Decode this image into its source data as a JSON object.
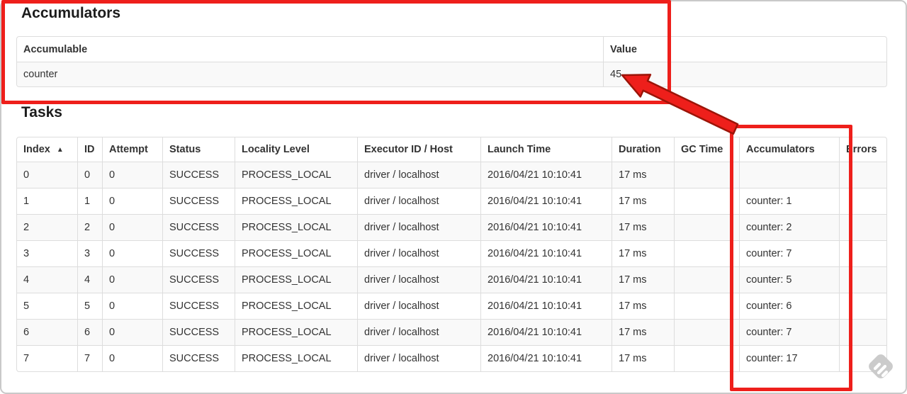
{
  "annotation_color": "#ee1f1b",
  "accumulators_section": {
    "heading": "Accumulators",
    "table": {
      "headers": {
        "accumulable": "Accumulable",
        "value": "Value"
      },
      "row": {
        "accumulable": "counter",
        "value": "45"
      }
    }
  },
  "tasks_section": {
    "heading": "Tasks",
    "table": {
      "headers": [
        "Index",
        "ID",
        "Attempt",
        "Status",
        "Locality Level",
        "Executor ID / Host",
        "Launch Time",
        "Duration",
        "GC Time",
        "Accumulators",
        "Errors"
      ],
      "sort": {
        "column": "Index",
        "direction_icon": "▲"
      },
      "rows": [
        {
          "index": "0",
          "id": "0",
          "attempt": "0",
          "status": "SUCCESS",
          "locality_level": "PROCESS_LOCAL",
          "executor_id_host": "driver / localhost",
          "launch_time": "2016/04/21 10:10:41",
          "duration": "17 ms",
          "gc_time": "",
          "accumulators": "",
          "errors": ""
        },
        {
          "index": "1",
          "id": "1",
          "attempt": "0",
          "status": "SUCCESS",
          "locality_level": "PROCESS_LOCAL",
          "executor_id_host": "driver / localhost",
          "launch_time": "2016/04/21 10:10:41",
          "duration": "17 ms",
          "gc_time": "",
          "accumulators": "counter: 1",
          "errors": ""
        },
        {
          "index": "2",
          "id": "2",
          "attempt": "0",
          "status": "SUCCESS",
          "locality_level": "PROCESS_LOCAL",
          "executor_id_host": "driver / localhost",
          "launch_time": "2016/04/21 10:10:41",
          "duration": "17 ms",
          "gc_time": "",
          "accumulators": "counter: 2",
          "errors": ""
        },
        {
          "index": "3",
          "id": "3",
          "attempt": "0",
          "status": "SUCCESS",
          "locality_level": "PROCESS_LOCAL",
          "executor_id_host": "driver / localhost",
          "launch_time": "2016/04/21 10:10:41",
          "duration": "17 ms",
          "gc_time": "",
          "accumulators": "counter: 7",
          "errors": ""
        },
        {
          "index": "4",
          "id": "4",
          "attempt": "0",
          "status": "SUCCESS",
          "locality_level": "PROCESS_LOCAL",
          "executor_id_host": "driver / localhost",
          "launch_time": "2016/04/21 10:10:41",
          "duration": "17 ms",
          "gc_time": "",
          "accumulators": "counter: 5",
          "errors": ""
        },
        {
          "index": "5",
          "id": "5",
          "attempt": "0",
          "status": "SUCCESS",
          "locality_level": "PROCESS_LOCAL",
          "executor_id_host": "driver / localhost",
          "launch_time": "2016/04/21 10:10:41",
          "duration": "17 ms",
          "gc_time": "",
          "accumulators": "counter: 6",
          "errors": ""
        },
        {
          "index": "6",
          "id": "6",
          "attempt": "0",
          "status": "SUCCESS",
          "locality_level": "PROCESS_LOCAL",
          "executor_id_host": "driver / localhost",
          "launch_time": "2016/04/21 10:10:41",
          "duration": "17 ms",
          "gc_time": "",
          "accumulators": "counter: 7",
          "errors": ""
        },
        {
          "index": "7",
          "id": "7",
          "attempt": "0",
          "status": "SUCCESS",
          "locality_level": "PROCESS_LOCAL",
          "executor_id_host": "driver / localhost",
          "launch_time": "2016/04/21 10:10:41",
          "duration": "17 ms",
          "gc_time": "",
          "accumulators": "counter: 17",
          "errors": ""
        }
      ]
    }
  }
}
